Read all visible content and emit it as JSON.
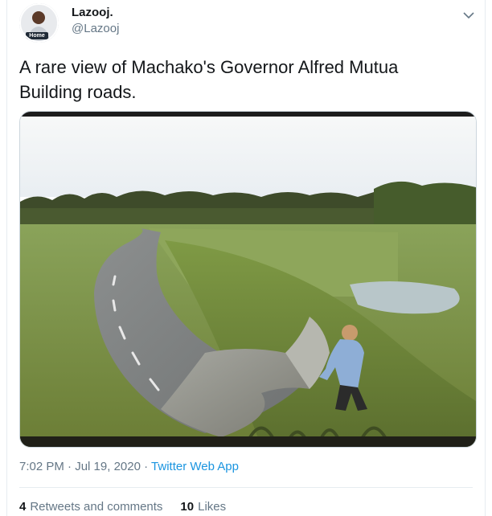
{
  "author": {
    "display_name": "Lazooj.",
    "handle": "@Lazooj",
    "avatar_badge": "Home"
  },
  "tweet": {
    "text_line1": "A rare view of Machako's Governor Alfred Mutua",
    "text_line2": "Building roads."
  },
  "meta": {
    "time": "7:02 PM",
    "separator1": "·",
    "date": "Jul 19, 2020",
    "separator2": "·",
    "source": "Twitter Web App"
  },
  "stats": {
    "retweets_count": "4",
    "retweets_label": "Retweets and comments",
    "likes_count": "10",
    "likes_label": "Likes"
  },
  "icons": {
    "caret": "chevron-down-icon"
  },
  "colors": {
    "link": "#1b95e0",
    "secondary_text": "#657786",
    "primary_text": "#14171a"
  }
}
